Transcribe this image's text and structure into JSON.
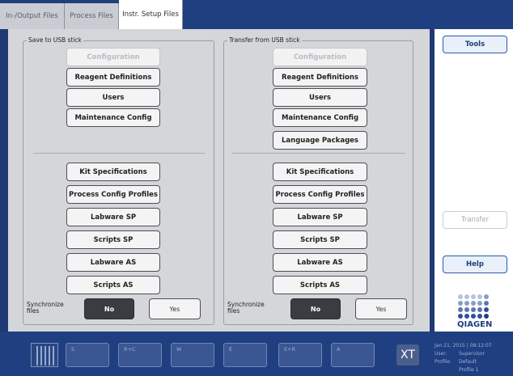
{
  "tabs": [
    {
      "label": "In-/Output Files",
      "active": false
    },
    {
      "label": "Process Files",
      "active": false
    },
    {
      "label": "Instr. Setup Files",
      "active": true
    }
  ],
  "save_group": {
    "title": "Save to USB stick",
    "buttons": {
      "configuration": "Configuration",
      "reagent_definitions": "Reagent Definitions",
      "users": "Users",
      "maintenance_config": "Maintenance Config",
      "kit_specifications": "Kit Specifications",
      "process_config_profiles": "Process Config Profiles",
      "labware_sp": "Labware SP",
      "scripts_sp": "Scripts SP",
      "labware_as": "Labware AS",
      "scripts_as": "Scripts AS"
    },
    "sync_label": "Synchronize files",
    "sync_no": "No",
    "sync_yes": "Yes",
    "sync_selected": "No"
  },
  "transfer_group": {
    "title": "Transfer from USB stick",
    "buttons": {
      "configuration": "Configuration",
      "reagent_definitions": "Reagent Definitions",
      "users": "Users",
      "maintenance_config": "Maintenance Config",
      "language_packages": "Language Packages",
      "kit_specifications": "Kit Specifications",
      "process_config_profiles": "Process Config Profiles",
      "labware_sp": "Labware SP",
      "scripts_sp": "Scripts SP",
      "labware_as": "Labware AS",
      "scripts_as": "Scripts AS"
    },
    "sync_label": "Synchronize files",
    "sync_no": "No",
    "sync_yes": "Yes",
    "sync_selected": "No"
  },
  "side": {
    "tools": "Tools",
    "transfer": "Transfer",
    "help": "Help",
    "logo": "QIAGEN"
  },
  "bottom": {
    "slots": [
      "S",
      "R+C",
      "W",
      "E",
      "E+R",
      "A"
    ],
    "xt_label": "XT",
    "datetime": "Jan 21, 2015 | 08:12:07",
    "user_label": "User:",
    "user_value": "Supervisor",
    "profile_label": "Profile:",
    "profile_value": "Default Profile 1"
  },
  "colors": {
    "brand_blue": "#1f3f80",
    "panel_gray": "#d4d6da",
    "accent_blue": "#2b5aa8"
  }
}
